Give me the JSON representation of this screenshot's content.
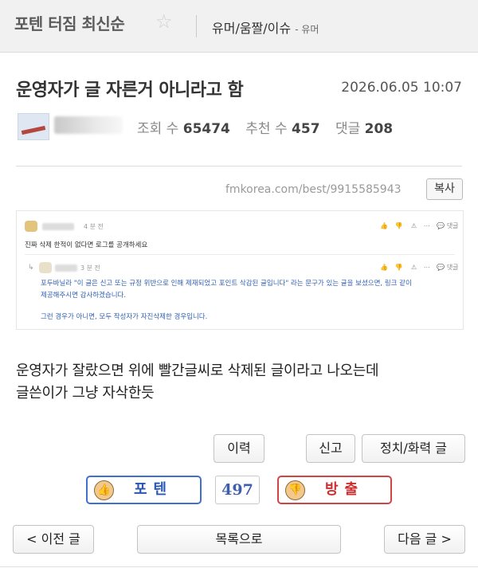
{
  "board": {
    "title": "포텐 터짐 최신순",
    "category": "유머/움짤/이슈",
    "subcategory": "- 유머"
  },
  "post": {
    "title": "운영자가 글 자른거 아니라고 함",
    "date": "2026.06.05 10:07",
    "views_label": "조회 수",
    "views": "65474",
    "likes_label": "추천 수",
    "likes": "457",
    "comments_label": "댓글",
    "comments": "208",
    "url": "fmkorea.com/best/9915585943",
    "copy_label": "복사",
    "body_lines": [
      "운영자가 잘랐으면 위에 빨간글씨로 삭제된 글이라고 나오는데",
      "글쓴이가 그냥 자삭한듯"
    ]
  },
  "embedded_comments": [
    {
      "time": "4 분 전",
      "text": "진짜 삭제 한적이 없다면 로그를 공개하세요",
      "reply_label": "댓글"
    },
    {
      "time": "3 분 전",
      "lines": [
        "포두바닐라 \"이 글은 신고 또는 규정 위반으로 인해 제재되었고 포인트 삭감된 글입니다\" 라는 문구가 있는 글을 보셨으면, 링크 같이",
        "제공해주시면 감사하겠습니다.",
        "",
        "그런 경우가 아니면, 모두 작성자가 자진삭제한 경우입니다."
      ],
      "reply_label": "댓글"
    }
  ],
  "buttons": {
    "history": "이력",
    "report": "신고",
    "politics": "정치/화력 글",
    "prev": "< 이전 글",
    "list": "목록으로",
    "next": "다음 글 >"
  },
  "vote": {
    "up_label": "포텐",
    "count": "497",
    "down_label": "방출"
  },
  "colors": {
    "vote_up": "#3f6fd0",
    "vote_down": "#d04444",
    "link_blue": "#2f5fb5"
  }
}
